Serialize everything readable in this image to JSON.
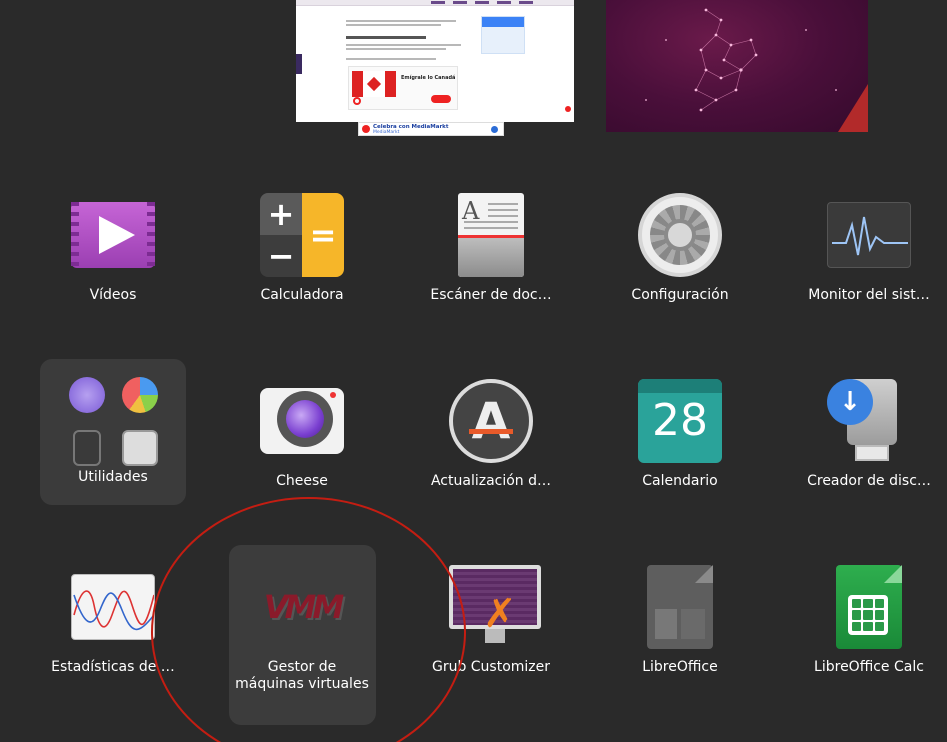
{
  "workspaces": {
    "browser_banner": {
      "title": "Celebra con MediaMarkt",
      "brand": "MediaMarkt"
    },
    "browser_ad_title": "Emígrale lo Canadá"
  },
  "apps": [
    {
      "id": "videos",
      "label": "Vídeos"
    },
    {
      "id": "calculator",
      "label": "Calculadora"
    },
    {
      "id": "scanner",
      "label": "Escáner de doc…"
    },
    {
      "id": "settings",
      "label": "Configuración"
    },
    {
      "id": "system-monitor",
      "label": "Monitor del sist…"
    },
    {
      "id": "utilities",
      "label": "Utilidades"
    },
    {
      "id": "cheese",
      "label": "Cheese"
    },
    {
      "id": "software-updater",
      "label": "Actualización d…"
    },
    {
      "id": "calendar",
      "label": "Calendario",
      "icon_number": "28"
    },
    {
      "id": "disk-creator",
      "label": "Creador de disc…"
    },
    {
      "id": "power-stats",
      "label": "Estadísticas de …"
    },
    {
      "id": "virt-manager",
      "label": "Gestor de máquinas virtuales"
    },
    {
      "id": "grub-customizer",
      "label": "Grub Customizer"
    },
    {
      "id": "libreoffice",
      "label": "LibreOffice"
    },
    {
      "id": "libreoffice-calc",
      "label": "LibreOffice Calc"
    }
  ],
  "calculator_icon": {
    "plus": "+",
    "minus": "−",
    "equals": "="
  },
  "scanner_icon": {
    "letter": "A"
  },
  "updater_icon": {
    "letter": "A"
  },
  "virt_icon": {
    "text": "VMM"
  },
  "colors": {
    "background": "#2a2a2a",
    "annotation": "#c41d12",
    "selected_tile": "#3c3c3c"
  }
}
